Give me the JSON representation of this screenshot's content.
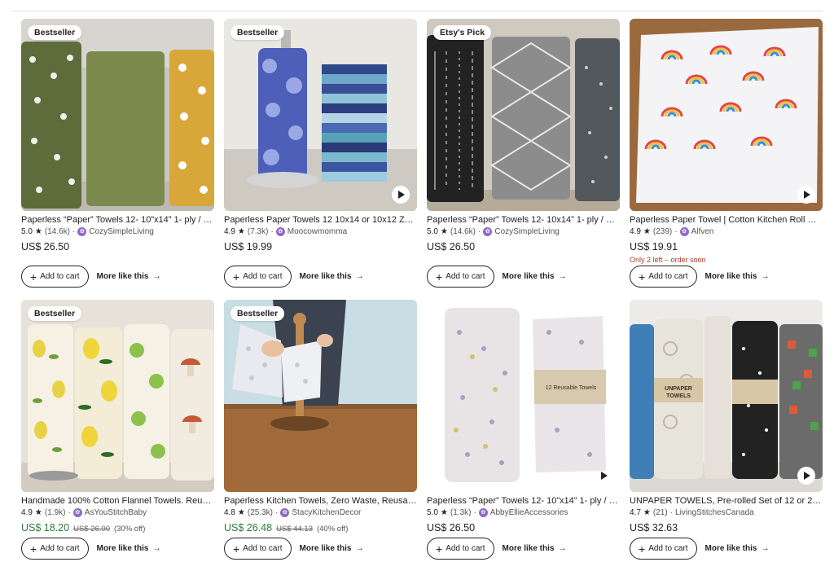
{
  "products": [
    {
      "badge": "Bestseller",
      "has_video": false,
      "title": "Paperless “Paper” Towels 12- 10”x14” 1- ply / E...",
      "rating": "5.0",
      "reviews": "(14.6k)",
      "shop": "CozySimpleLiving",
      "price": "US$ 26.50",
      "add_label": "Add to cart",
      "more_label": "More like this"
    },
    {
      "badge": "Bestseller",
      "has_video": true,
      "title": "Paperless Paper Towels 12 10x14 or 10x12 Zero ...",
      "rating": "4.9",
      "reviews": "(7.3k)",
      "shop": "Moocowmomma",
      "price": "US$ 19.99",
      "add_label": "Add to cart",
      "more_label": "More like this"
    },
    {
      "badge": "Etsy's Pick",
      "has_video": false,
      "title": "Paperless “Paper” Towels 12- 10x14” 1- ply / Pa...",
      "rating": "5.0",
      "reviews": "(14.6k)",
      "shop": "CozySimpleLiving",
      "price": "US$ 26.50",
      "add_label": "Add to cart",
      "more_label": "More like this"
    },
    {
      "badge": "",
      "has_video": true,
      "title": "Paperless Paper Towel | Cotton Kitchen Roll Re...",
      "rating": "4.9",
      "reviews": "(239)",
      "shop": "Alfven",
      "price": "US$ 19.91",
      "stock_note": "Only 2 left – order soon",
      "add_label": "Add to cart",
      "more_label": "More like this"
    },
    {
      "badge": "Bestseller",
      "has_video": false,
      "title": "Handmade 100% Cotton Flannel Towels. Reus...",
      "rating": "4.9",
      "reviews": "(1.9k)",
      "shop": "AsYouStitchBaby",
      "price": "US$ 18.20",
      "original_price": "US$ 26.00",
      "discount": "(30% off)",
      "add_label": "Add to cart",
      "more_label": "More like this"
    },
    {
      "badge": "Bestseller",
      "has_video": false,
      "title": "Paperless Kitchen Towels, Zero Waste, Reusab...",
      "rating": "4.8",
      "reviews": "(25.3k)",
      "shop": "StacyKitchenDecor",
      "price": "US$ 26.48",
      "original_price": "US$ 44.13",
      "discount": "(40% off)",
      "add_label": "Add to cart",
      "more_label": "More like this"
    },
    {
      "badge": "",
      "has_video": true,
      "title": "Paperless “Paper” Towels 12- 10”x14” 1- ply / E...",
      "rating": "5.0",
      "reviews": "(1.3k)",
      "shop": "AbbyEllieAccessories",
      "price": "US$ 26.50",
      "add_label": "Add to cart",
      "more_label": "More like this"
    },
    {
      "badge": "",
      "has_video": true,
      "title": "UNPAPER TOWELS, Pre-rolled Set of 12 or 24, ...",
      "rating": "4.7",
      "reviews": "(21)",
      "shop": "LivingStitchesCanada",
      "price": "US$ 32.63",
      "add_label": "Add to cart",
      "more_label": "More like this"
    }
  ],
  "image_labels": {
    "p7_band": "12 Reusable Towels",
    "p8_band": "UNPAPER TOWELS"
  },
  "colors": {
    "sale_price": "#2d7a3e",
    "stock_warning": "#b23a2a",
    "shop_icon": "#8f6ac9"
  }
}
